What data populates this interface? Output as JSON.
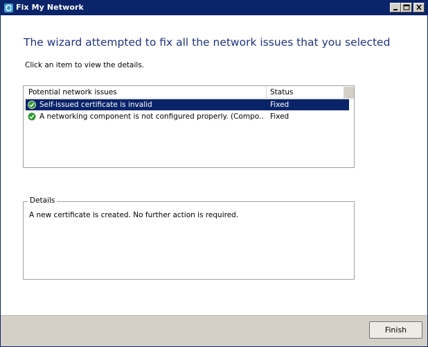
{
  "window": {
    "title": "Fix My Network",
    "controls": {
      "minimize_icon": "minimize-icon",
      "maximize_icon": "maximize-icon",
      "close_icon": "close-icon"
    }
  },
  "main": {
    "heading": "The wizard attempted to fix all the network issues that you selected",
    "instruction": "Click an item to view the details."
  },
  "issues_list": {
    "columns": [
      "Potential network issues",
      "Status"
    ],
    "rows": [
      {
        "issue": "Self-issued certificate is invalid",
        "status": "Fixed",
        "icon": "check-icon",
        "selected": true
      },
      {
        "issue": "A networking component is not configured properly. (Compo...",
        "status": "Fixed",
        "icon": "check-icon",
        "selected": false
      }
    ]
  },
  "details": {
    "legend": "Details",
    "text": "A new certificate is created. No further action is required."
  },
  "footer": {
    "finish_label": "Finish"
  },
  "colors": {
    "titlebar": "#0a246a",
    "heading": "#1e3287",
    "selection": "#0a246a",
    "success": "#2e9a2e"
  }
}
